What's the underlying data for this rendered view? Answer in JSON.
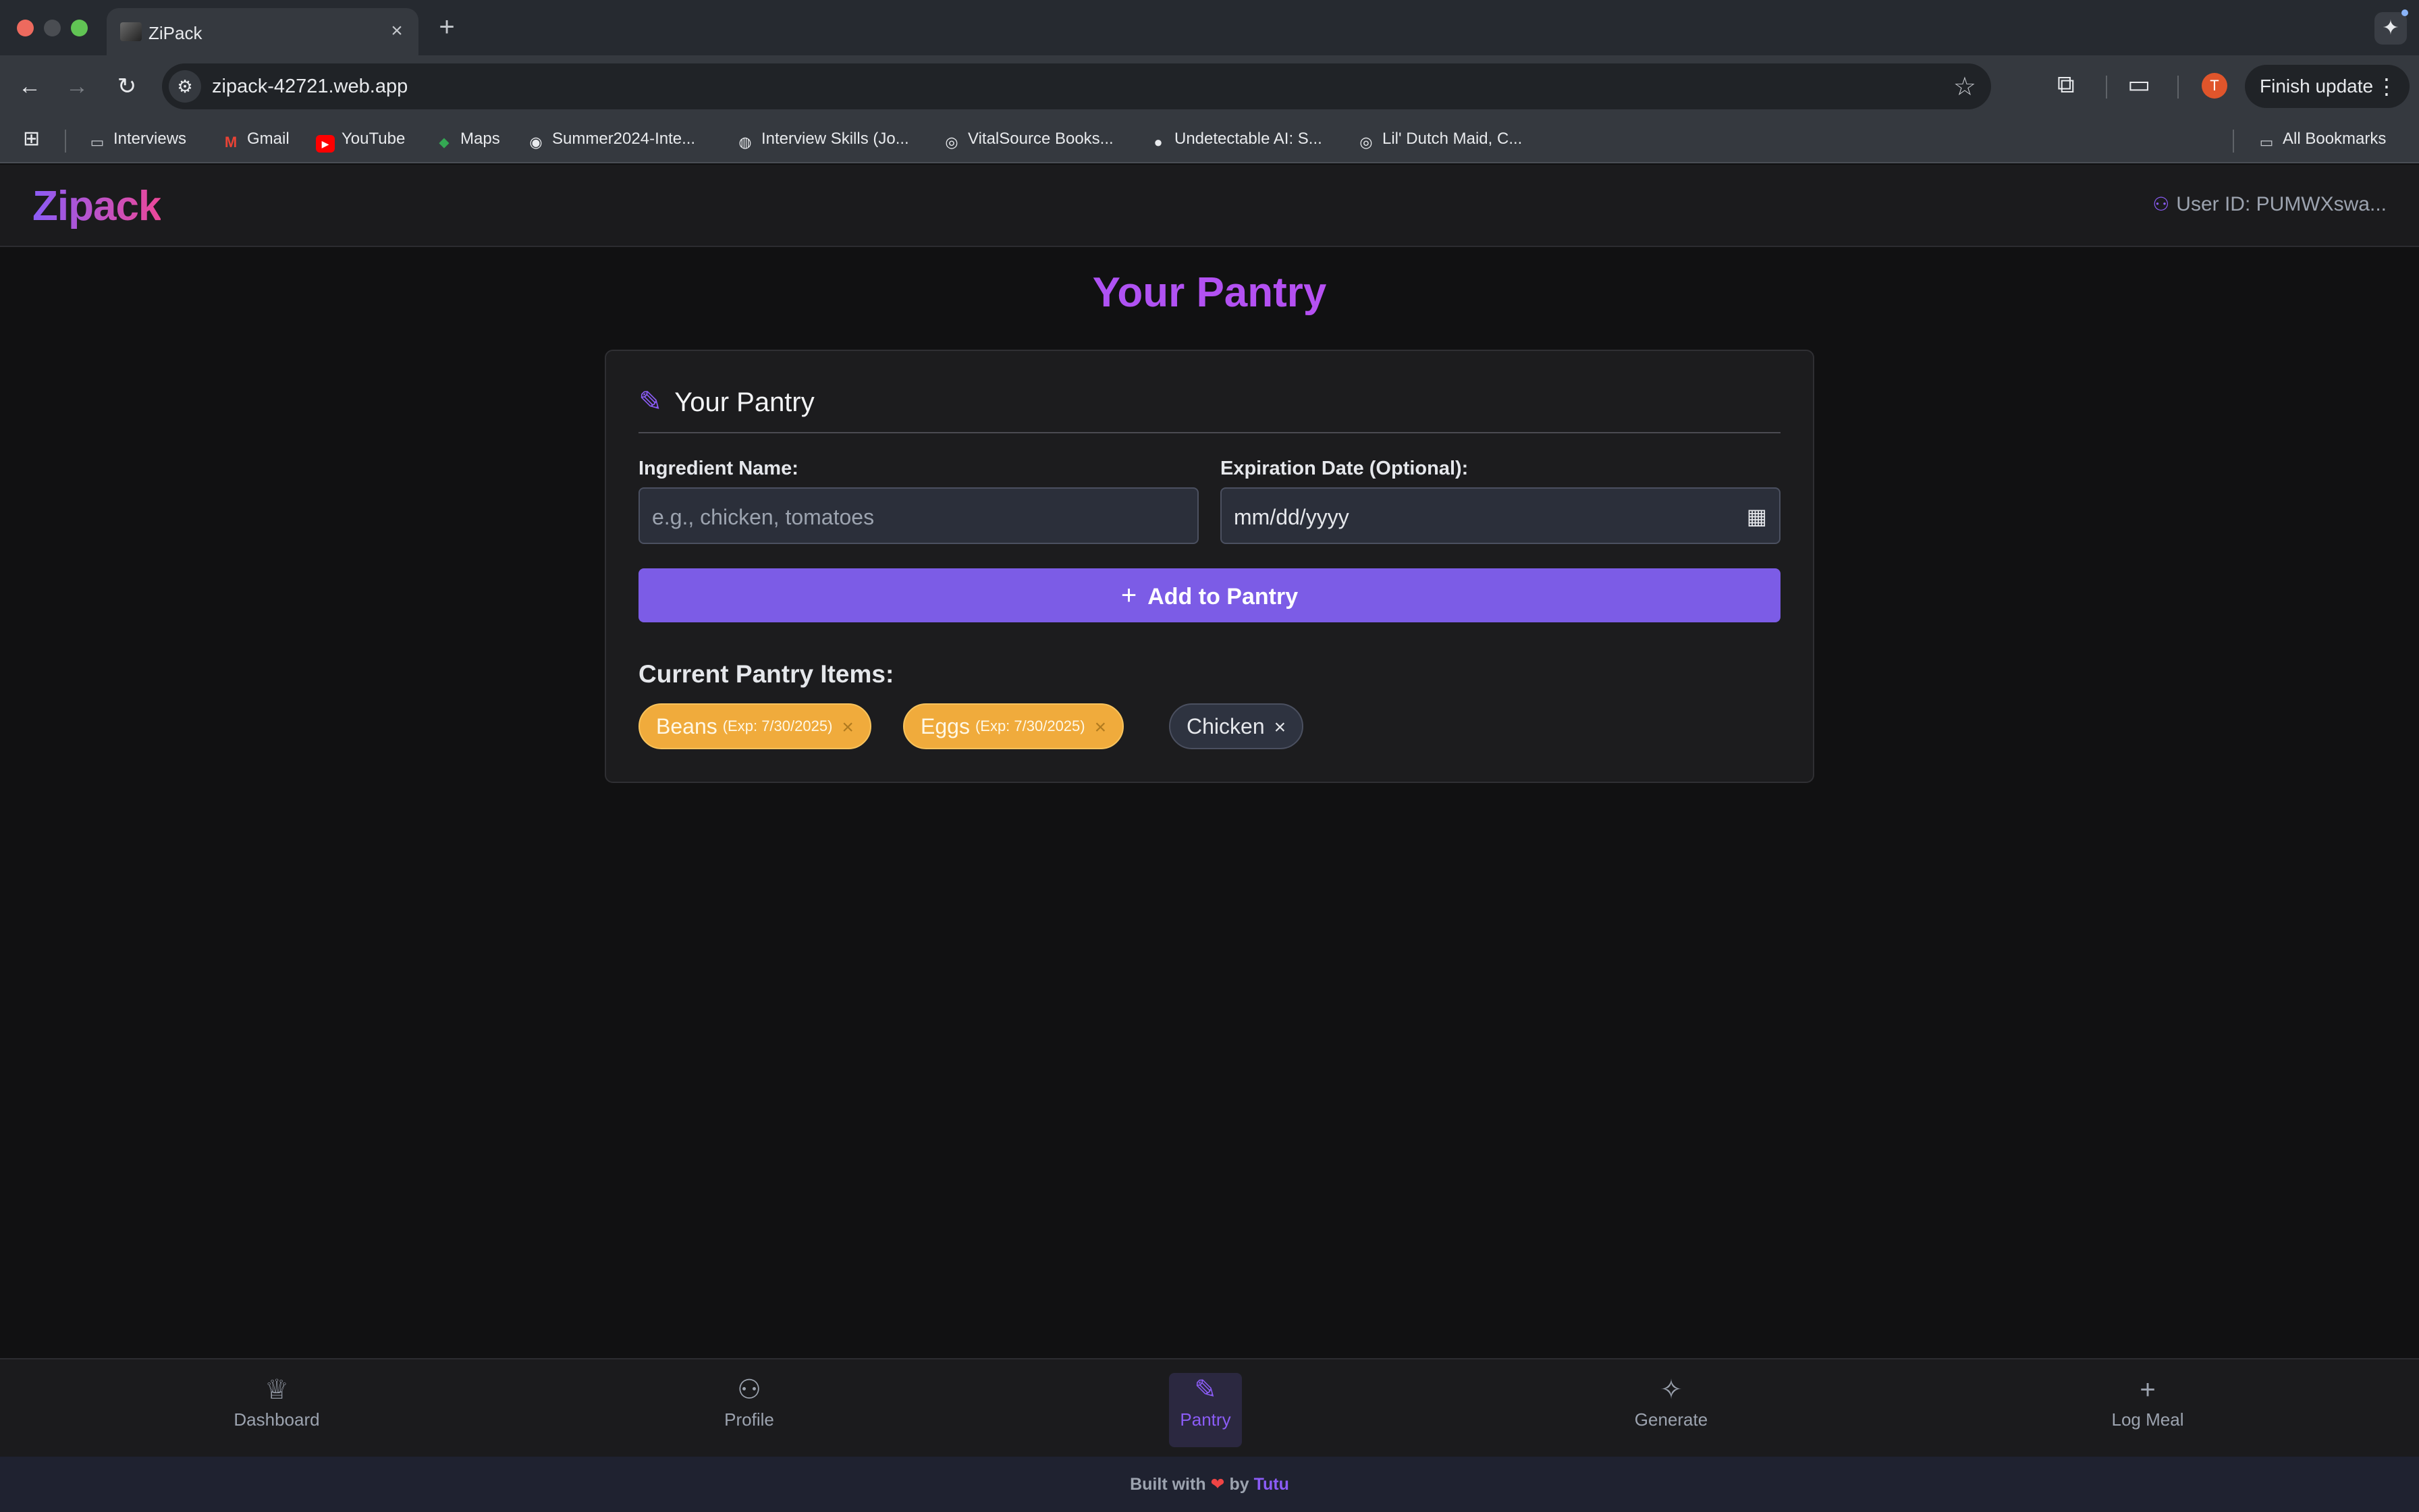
{
  "browser": {
    "tab_title": "ZiPack",
    "url": "zipack-42721.web.app",
    "avatar_letter": "T",
    "finish_update_label": "Finish update",
    "bookmarks": [
      {
        "label": "Interviews",
        "icon": "folder-icon"
      },
      {
        "label": "Gmail",
        "icon": "gmail-icon"
      },
      {
        "label": "YouTube",
        "icon": "youtube-icon"
      },
      {
        "label": "Maps",
        "icon": "maps-icon"
      },
      {
        "label": "Summer2024-Inte...",
        "icon": "github-icon"
      },
      {
        "label": "Interview Skills (Jo...",
        "icon": "site-icon"
      },
      {
        "label": "VitalSource Books...",
        "icon": "globe-icon"
      },
      {
        "label": "Undetectable AI: S...",
        "icon": "site-icon"
      },
      {
        "label": "Lil' Dutch Maid, C...",
        "icon": "globe-icon"
      }
    ],
    "all_bookmarks_label": "All Bookmarks"
  },
  "app": {
    "brand": "Zipack",
    "user_id": "User ID: PUMWXswa...",
    "page_title": "Your Pantry",
    "card": {
      "title": "Your Pantry",
      "ingredient_label": "Ingredient Name:",
      "ingredient_placeholder": "e.g., chicken, tomatoes",
      "expiration_label": "Expiration Date (Optional):",
      "expiration_placeholder": "mm/dd/yyyy",
      "add_button_label": "Add to Pantry",
      "items_title": "Current Pantry Items:",
      "items": [
        {
          "name": "Beans",
          "exp": "(Exp: 7/30/2025)",
          "status": "expiring"
        },
        {
          "name": "Eggs",
          "exp": "(Exp: 7/30/2025)",
          "status": "expiring"
        },
        {
          "name": "Chicken",
          "exp": "",
          "status": "normal"
        }
      ]
    },
    "bottom_nav": [
      {
        "label": "Dashboard",
        "icon": "chef-hat-icon",
        "active": false
      },
      {
        "label": "Profile",
        "icon": "user-icon",
        "active": false
      },
      {
        "label": "Pantry",
        "icon": "carrot-icon",
        "active": true
      },
      {
        "label": "Generate",
        "icon": "sparkles-icon",
        "active": false
      },
      {
        "label": "Log Meal",
        "icon": "plus-icon",
        "active": false
      }
    ],
    "footer": {
      "prefix": "Built with",
      "by": "by",
      "author": "Tutu"
    }
  },
  "colors": {
    "accent": "#8b5cf6",
    "button": "#7c5ce6",
    "warning_chip": "#f0ab3c",
    "background": "#111112"
  }
}
